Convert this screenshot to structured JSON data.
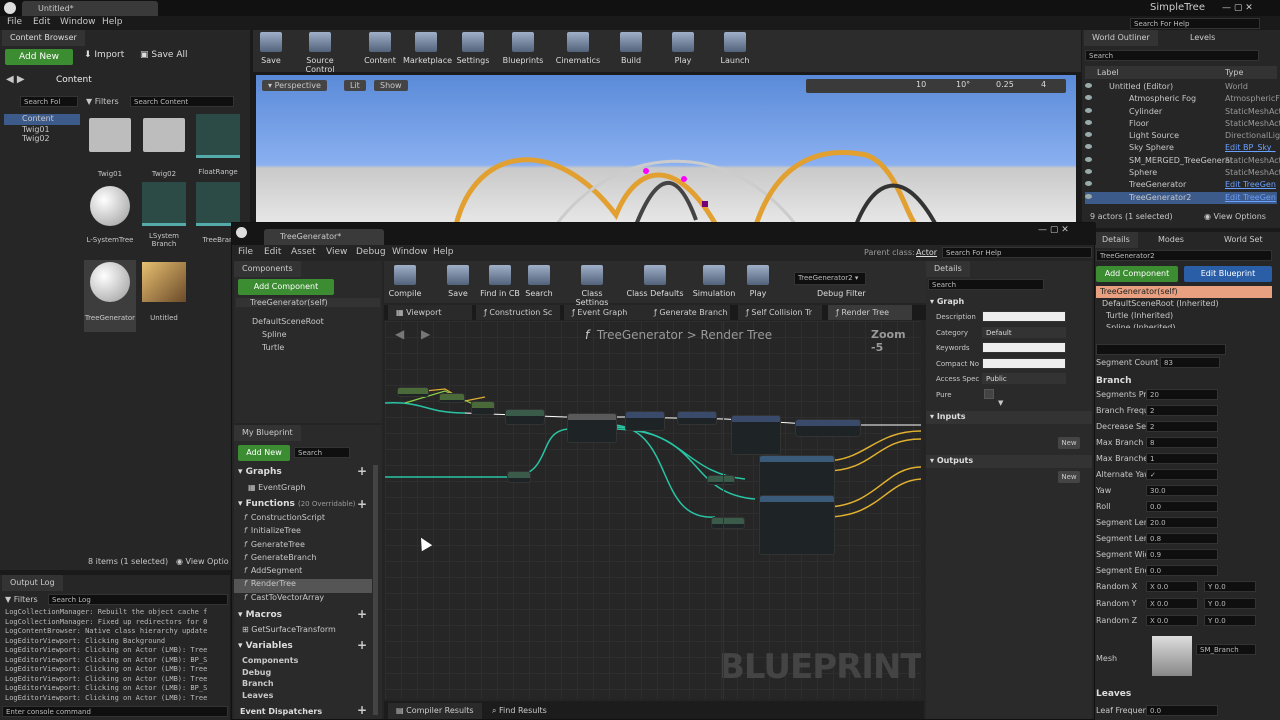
{
  "titlebar": {
    "doc_tab": "Untitled*",
    "app_title": "SimpleTree",
    "search": "Search For Help"
  },
  "menu": [
    "File",
    "Edit",
    "Window",
    "Help"
  ],
  "content_browser": {
    "tab": "Content Browser",
    "add_new": "Add New",
    "import": "Import",
    "save_all": "Save All",
    "path": "Content",
    "search_folders": "Search Fol",
    "filters": "Filters",
    "search_content": "Search Content",
    "folders": [
      "Content",
      "Twig01",
      "Twig02"
    ],
    "assets": [
      {
        "name": "Twig01",
        "kind": "folder"
      },
      {
        "name": "Twig02",
        "kind": "folder"
      },
      {
        "name": "FloatRange",
        "kind": "struct"
      },
      {
        "name": "L-SystemTree",
        "kind": "sphere"
      },
      {
        "name": "LSystem Branch",
        "kind": "struct"
      },
      {
        "name": "TreeBran",
        "kind": "struct"
      },
      {
        "name": "TreeGenerator",
        "kind": "sphere"
      },
      {
        "name": "Untitled",
        "kind": "level"
      }
    ],
    "status": "8 items (1 selected)",
    "view_options": "View Optio"
  },
  "toolbar": [
    "Save",
    "Source Control",
    "Content",
    "Marketplace",
    "Settings",
    "Blueprints",
    "Cinematics",
    "Build",
    "Play",
    "Launch"
  ],
  "viewport": {
    "perspective": "Perspective",
    "lit": "Lit",
    "show": "Show",
    "snap1": "10",
    "snap2": "10°",
    "snap3": "0.25",
    "snap4": "4"
  },
  "outliner": {
    "tab": "World Outliner",
    "tab2": "Levels",
    "search": "Search",
    "col_label": "Label",
    "col_type": "Type",
    "items": [
      {
        "label": "Untitled (Editor)",
        "type": "World"
      },
      {
        "label": "Atmospheric Fog",
        "type": "AtmosphericFo"
      },
      {
        "label": "Cylinder",
        "type": "StaticMeshAct"
      },
      {
        "label": "Floor",
        "type": "StaticMeshAct"
      },
      {
        "label": "Light Source",
        "type": "DirectionalLig"
      },
      {
        "label": "Sky Sphere",
        "type": "Edit BP_Sky_"
      },
      {
        "label": "SM_MERGED_TreeGenerat",
        "type": "StaticMeshAct"
      },
      {
        "label": "Sphere",
        "type": "StaticMeshAct"
      },
      {
        "label": "TreeGenerator",
        "type": "Edit TreeGen"
      },
      {
        "label": "TreeGenerator2",
        "type": "Edit TreeGen"
      }
    ],
    "status": "9 actors (1 selected)",
    "view_options": "View Options"
  },
  "details": {
    "tab": "Details",
    "tab2": "Modes",
    "tab3": "World Set",
    "name": "TreeGenerator2",
    "add_component": "Add Component",
    "edit_bp": "Edit Blueprint",
    "components": [
      "TreeGenerator(self)",
      "DefaultSceneRoot (Inherited)",
      "Turtle (Inherited)",
      "Spline (Inherited)"
    ],
    "segment_count_label": "Segment Count",
    "segment_count": "83",
    "branch_section": "Branch",
    "props": [
      {
        "label": "Segments Pr Br",
        "value": "20"
      },
      {
        "label": "Branch Frequen",
        "value": "2"
      },
      {
        "label": "Decrease Segm",
        "value": "2"
      },
      {
        "label": "Max Branch Len",
        "value": "8"
      },
      {
        "label": "Max Branches",
        "value": "1"
      },
      {
        "label": "Alternate Yaw",
        "value": "✓"
      },
      {
        "label": "Yaw",
        "value": "30.0"
      },
      {
        "label": "Roll",
        "value": "0.0"
      },
      {
        "label": "Segment Length",
        "value": "20.0"
      },
      {
        "label": "Segment Length F",
        "value": "0.8"
      },
      {
        "label": "Segment Width",
        "value": "0.9"
      },
      {
        "label": "Segment End Widt",
        "value": "0.0"
      }
    ],
    "randoms": [
      {
        "label": "Random X",
        "x": "0.0",
        "y": "0.0"
      },
      {
        "label": "Random Y",
        "x": "0.0",
        "y": "0.0"
      },
      {
        "label": "Random Z",
        "x": "0.0",
        "y": "0.0"
      }
    ],
    "mesh_label": "Mesh",
    "mesh": "SM_Branch",
    "leaves": "Leaves",
    "leaf_freq_label": "Leaf Frequency",
    "leaf_freq": "0.0"
  },
  "output_log": {
    "tab": "Output Log",
    "filters": "Filters",
    "search": "Search Log",
    "lines": [
      "LogCollectionManager: Rebuilt the object cache f",
      "LogCollectionManager: Fixed up redirectors for 0",
      "LogContentBrowser: Native class hierarchy update",
      "LogEditorViewport: Clicking Background",
      "LogEditorViewport: Clicking on Actor (LMB): Tree",
      "LogEditorViewport: Clicking on Actor (LMB): BP_S",
      "LogEditorViewport: Clicking on Actor (LMB): Tree",
      "LogEditorViewport: Clicking on Actor (LMB): Tree",
      "LogEditorViewport: Clicking on Actor (LMB): BP_S",
      "LogEditorViewport: Clicking on Actor (LMB): Tree"
    ],
    "console": "Enter console command"
  },
  "bp_editor": {
    "tab": "TreeGenerator*",
    "parent_label": "Parent class:",
    "parent": "Actor",
    "search_help": "Search For Help",
    "menu": [
      "File",
      "Edit",
      "Asset",
      "View",
      "Debug",
      "Window",
      "Help"
    ],
    "components_tab": "Components",
    "add_component": "Add Component",
    "self": "TreeGenerator(self)",
    "tree": [
      "DefaultSceneRoot",
      "Spline",
      "Turtle"
    ],
    "toolbar": [
      "Compile",
      "Save",
      "Find in CB",
      "Search",
      "Class Settings",
      "Class Defaults",
      "Simulation",
      "Play"
    ],
    "debug_object": "TreeGenerator2",
    "debug_filter": "Debug Filter",
    "graph_tabs": [
      "Viewport",
      "Construction Sc",
      "Event Graph",
      "Generate Branch",
      "Self Collision Tr",
      "Render Tree"
    ],
    "breadcrumb_root": "TreeGenerator",
    "breadcrumb_sep": ">",
    "breadcrumb_leaf": "Render Tree",
    "zoom": "Zoom -5",
    "watermark": "BLUEPRINT",
    "bottom_tabs": [
      "Compiler Results",
      "Find Results"
    ],
    "my_blueprint": "My Blueprint",
    "add_new": "Add New",
    "search": "Search",
    "graphs": "Graphs",
    "event_graph": "EventGraph",
    "functions": "Functions",
    "functions_count": "(20 Overridable)",
    "function_list": [
      "ConstructionScript",
      "InitializeTree",
      "GenerateTree",
      "GenerateBranch",
      "AddSegment",
      "RenderTree",
      "CastToVectorArray"
    ],
    "macros": "Macros",
    "macro_list": [
      "GetSurfaceTransform"
    ],
    "variables": "Variables",
    "var_groups": [
      "Components",
      "Debug",
      "Branch",
      "Leaves"
    ],
    "dispatchers": "Event Dispatchers",
    "details_tab": "Details",
    "details_search": "Search",
    "graph_section": "Graph",
    "graph_fields": [
      {
        "label": "Description",
        "value": ""
      },
      {
        "label": "Category",
        "value": "Default"
      },
      {
        "label": "Keywords",
        "value": ""
      },
      {
        "label": "Compact No",
        "value": ""
      },
      {
        "label": "Access Spec",
        "value": "Public"
      },
      {
        "label": "Pure",
        "value": ""
      }
    ],
    "inputs": "Inputs",
    "outputs": "Outputs",
    "new_btn": "New"
  },
  "colors": {
    "accent_green": "#3c8c32",
    "accent_blue": "#2a5fa8",
    "exec_wire": "#ffffff",
    "teal_wire": "#28c4a4",
    "yellow_wire": "#e0b030",
    "select_row": "#3c5a8a"
  }
}
